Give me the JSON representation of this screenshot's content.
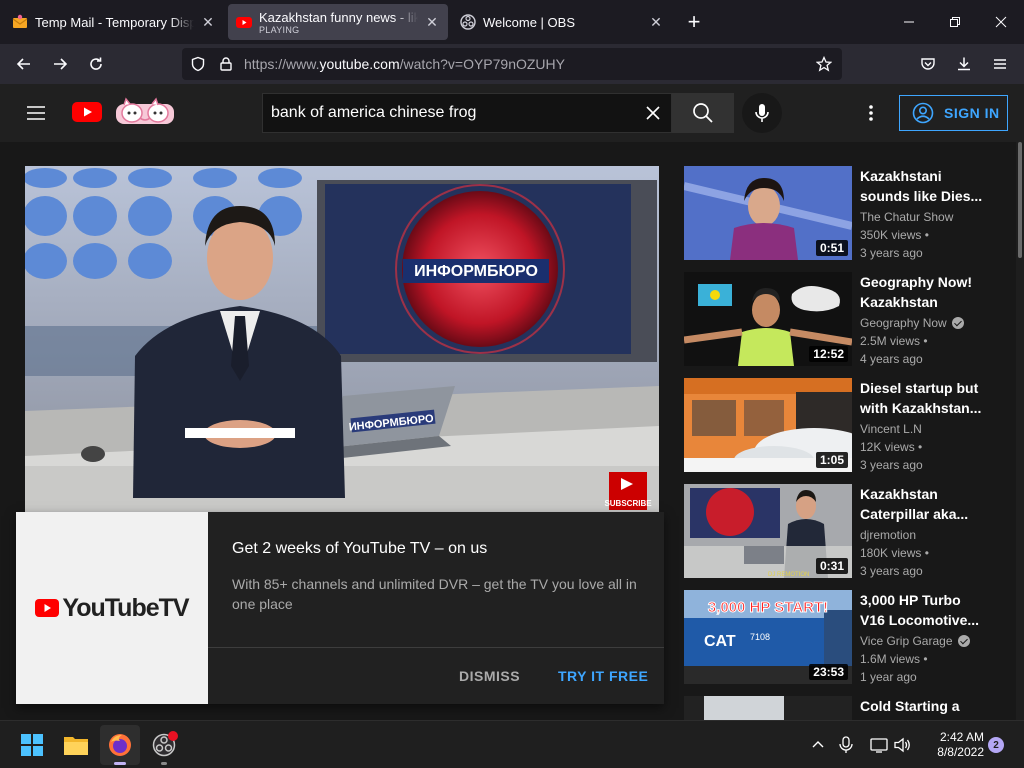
{
  "browser": {
    "tabs": [
      {
        "title": "Temp Mail - Temporary Disposable",
        "active": false
      },
      {
        "title": "Kazakhstan funny news - like dies",
        "subtitle": "PLAYING",
        "active": true
      },
      {
        "title": "Welcome | OBS",
        "active": false
      }
    ],
    "new_tab": "+",
    "url_prefix": "https://www.",
    "url_domain": "youtube.com",
    "url_path": "/watch?v=OYP79nOZUHY"
  },
  "youtube": {
    "search_value": "bank of america chinese frog",
    "sign_in_label": "SIGN IN",
    "player": {
      "channel_text": "ИНФОРМБЮРО",
      "laptop_text": "ИНФОРМБЮРО",
      "subscribe_label": "SUBSCRIBE"
    },
    "promo": {
      "logo_text": "YouTubeTV",
      "title": "Get 2 weeks of YouTube TV – on us",
      "description": "With 85+ channels and unlimited DVR – get the TV you love all in one place",
      "dismiss_label": "DISMISS",
      "try_label": "TRY IT FREE"
    },
    "recommendations": [
      {
        "title": "Kazakhstani sounds like Dies...",
        "channel": "The Chatur Show",
        "verified": false,
        "views": "350K views •",
        "age": "3 years ago",
        "duration": "0:51"
      },
      {
        "title": "Geography Now! Kazakhstan",
        "channel": "Geography Now",
        "verified": true,
        "views": "2.5M views •",
        "age": "4 years ago",
        "duration": "12:52"
      },
      {
        "title": "Diesel startup but with Kazakhstan...",
        "channel": "Vincent L.N",
        "verified": false,
        "views": "12K views •",
        "age": "3 years ago",
        "duration": "1:05"
      },
      {
        "title": "Kazakhstan Caterpillar aka...",
        "channel": "djremotion",
        "verified": false,
        "views": "180K views •",
        "age": "3 years ago",
        "duration": "0:31"
      },
      {
        "title": "3,000 HP Turbo V16 Locomotive...",
        "channel": "Vice Grip Garage",
        "verified": true,
        "views": "1.6M views •",
        "age": "1 year ago",
        "duration": "23:53",
        "thumb_text": "3,000 HP START!",
        "thumb_number": "7108"
      },
      {
        "title": "Cold Starting a",
        "channel": "",
        "views": "",
        "age": "",
        "duration": ""
      }
    ]
  },
  "taskbar": {
    "time": "2:42 AM",
    "date": "8/8/2022",
    "notification_count": "2"
  }
}
